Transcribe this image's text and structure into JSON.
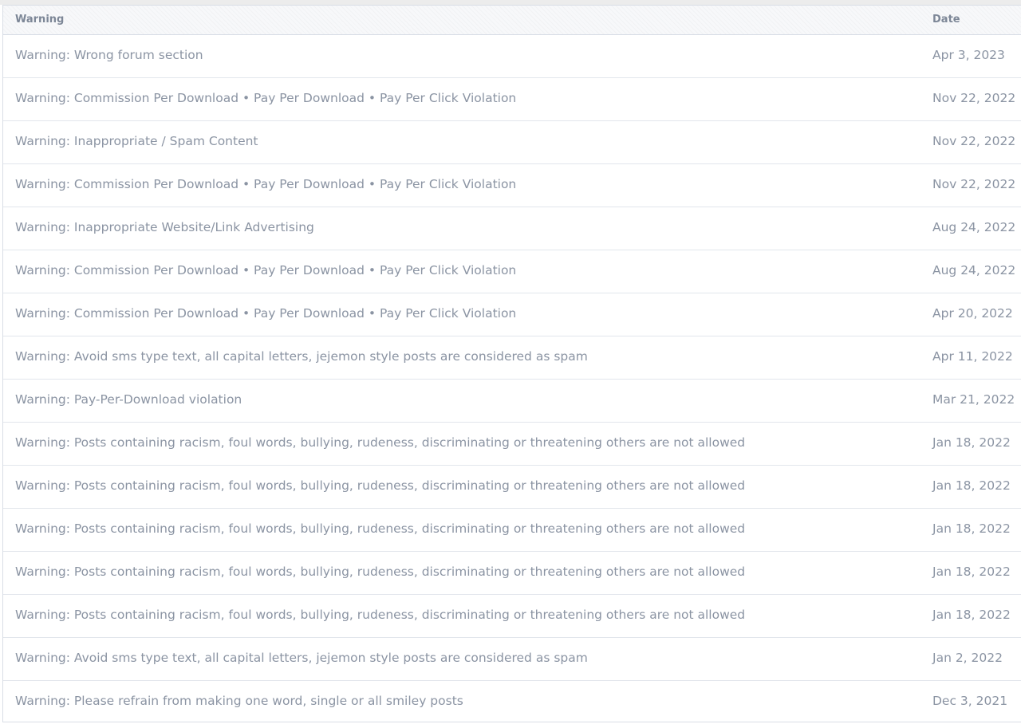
{
  "table": {
    "headers": {
      "warning": "Warning",
      "date": "Date"
    },
    "rows": [
      {
        "warning": "Warning: Wrong forum section",
        "date": "Apr 3, 2023"
      },
      {
        "warning": "Warning: Commission Per Download • Pay Per Download • Pay Per Click Violation",
        "date": "Nov 22, 2022"
      },
      {
        "warning": "Warning: Inappropriate / Spam Content",
        "date": "Nov 22, 2022"
      },
      {
        "warning": "Warning: Commission Per Download • Pay Per Download • Pay Per Click Violation",
        "date": "Nov 22, 2022"
      },
      {
        "warning": "Warning: Inappropriate Website/Link Advertising",
        "date": "Aug 24, 2022"
      },
      {
        "warning": "Warning: Commission Per Download • Pay Per Download • Pay Per Click Violation",
        "date": "Aug 24, 2022"
      },
      {
        "warning": "Warning: Commission Per Download • Pay Per Download • Pay Per Click Violation",
        "date": "Apr 20, 2022"
      },
      {
        "warning": "Warning: Avoid sms type text, all capital letters, jejemon style posts are considered as spam",
        "date": "Apr 11, 2022"
      },
      {
        "warning": "Warning: Pay-Per-Download violation",
        "date": "Mar 21, 2022"
      },
      {
        "warning": "Warning: Posts containing racism, foul words, bullying, rudeness, discriminating or threatening others are not allowed",
        "date": "Jan 18, 2022"
      },
      {
        "warning": "Warning: Posts containing racism, foul words, bullying, rudeness, discriminating or threatening others are not allowed",
        "date": "Jan 18, 2022"
      },
      {
        "warning": "Warning: Posts containing racism, foul words, bullying, rudeness, discriminating or threatening others are not allowed",
        "date": "Jan 18, 2022"
      },
      {
        "warning": "Warning: Posts containing racism, foul words, bullying, rudeness, discriminating or threatening others are not allowed",
        "date": "Jan 18, 2022"
      },
      {
        "warning": "Warning: Posts containing racism, foul words, bullying, rudeness, discriminating or threatening others are not allowed",
        "date": "Jan 18, 2022"
      },
      {
        "warning": "Warning: Avoid sms type text, all capital letters, jejemon style posts are considered as spam",
        "date": "Jan 2, 2022"
      },
      {
        "warning": "Warning: Please refrain from making one word, single or all smiley posts",
        "date": "Dec 3, 2021"
      }
    ]
  }
}
